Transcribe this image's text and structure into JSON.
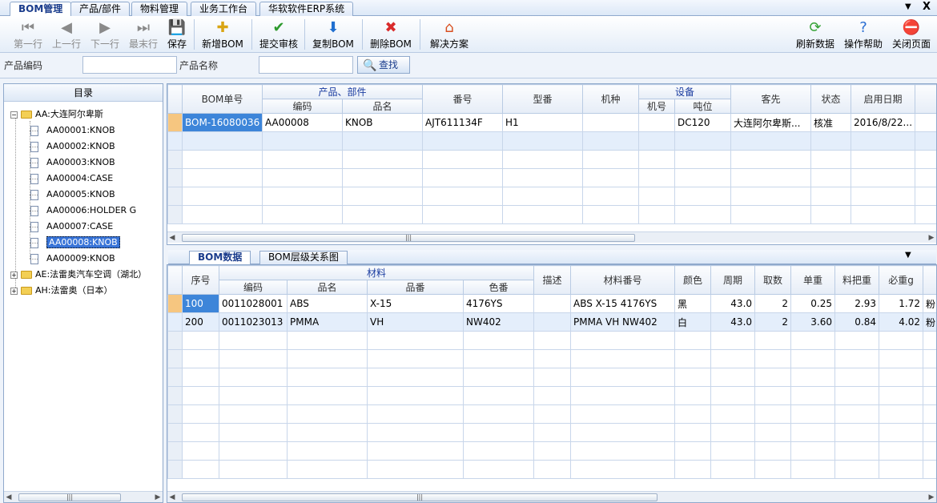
{
  "tabs": [
    "BOM管理",
    "产品/部件",
    "物料管理",
    "业务工作台",
    "华软软件ERP系统"
  ],
  "tab_controls": {
    "pin": "▼",
    "close": "X"
  },
  "toolbar": {
    "first": "第一行",
    "prev": "上一行",
    "next": "下一行",
    "last": "最末行",
    "save": "保存",
    "new_bom": "新增BOM",
    "submit": "提交审核",
    "copy_bom": "复制BOM",
    "delete_bom": "删除BOM",
    "solution": "解决方案",
    "refresh": "刷新数据",
    "help": "操作帮助",
    "close_page": "关闭页面"
  },
  "search": {
    "product_code_label": "产品编码",
    "product_name_label": "产品名称",
    "find_label": "查找"
  },
  "tree": {
    "header": "目录",
    "root": "AA:大连阿尔卑斯",
    "children": [
      "AA00001:KNOB",
      "AA00002:KNOB",
      "AA00003:KNOB",
      "AA00004:CASE",
      "AA00005:KNOB",
      "AA00006:HOLDER G",
      "AA00007:CASE",
      "AA00008:KNOB",
      "AA00009:KNOB"
    ],
    "others": [
      "AE:法雷奥汽车空调（湖北）",
      "AH:法雷奥（日本）"
    ]
  },
  "bom_grid": {
    "headers": {
      "bom_no": "BOM单号",
      "product_group": "产品、部件",
      "code": "编码",
      "name": "品名",
      "number": "番号",
      "model": "型番",
      "machine": "机种",
      "equipment_group": "设备",
      "machine_no": "机号",
      "tonnage": "吨位",
      "customer": "客先",
      "status": "状态",
      "start_date": "启用日期"
    },
    "rows": [
      {
        "bom_no": "BOM-16080036",
        "code": "AA00008",
        "name": "KNOB",
        "number": "AJT611134F",
        "model": "H1",
        "machine": "",
        "machine_no": "",
        "tonnage": "DC120",
        "customer": "大连阿尔卑斯...",
        "status": "核准",
        "start_date": "2016/8/22..."
      }
    ]
  },
  "subtabs": [
    "BOM数据",
    "BOM层级关系图"
  ],
  "subtab_pin": "▼",
  "material_grid": {
    "headers": {
      "seq": "序号",
      "material_group": "材料",
      "code": "编码",
      "name": "品名",
      "grade": "品番",
      "color_no": "色番",
      "desc": "描述",
      "material_no": "材料番号",
      "color": "颜色",
      "cycle": "周期",
      "cavity": "取数",
      "unit_weight": "单重",
      "runner_weight": "料把重",
      "required_g": "必重g"
    },
    "rows": [
      {
        "seq": "100",
        "code": "0011028001",
        "name": "ABS",
        "grade": "X-15",
        "color_no": "4176YS",
        "desc": "",
        "material_no": "ABS X-15 4176YS",
        "color": "黑",
        "cycle": "43.0",
        "cavity": "2",
        "unit_weight": "0.25",
        "runner_weight": "2.93",
        "required_g": "1.72",
        "extra": "粉"
      },
      {
        "seq": "200",
        "code": "0011023013",
        "name": "PMMA",
        "grade": "VH",
        "color_no": "NW402",
        "desc": "",
        "material_no": "PMMA VH NW402",
        "color": "白",
        "cycle": "43.0",
        "cavity": "2",
        "unit_weight": "3.60",
        "runner_weight": "0.84",
        "required_g": "4.02",
        "extra": "粉"
      }
    ]
  },
  "colors": {
    "accent": "#1a3c8c",
    "selection": "#3d85d9",
    "row_indicator": "#f6c680"
  }
}
